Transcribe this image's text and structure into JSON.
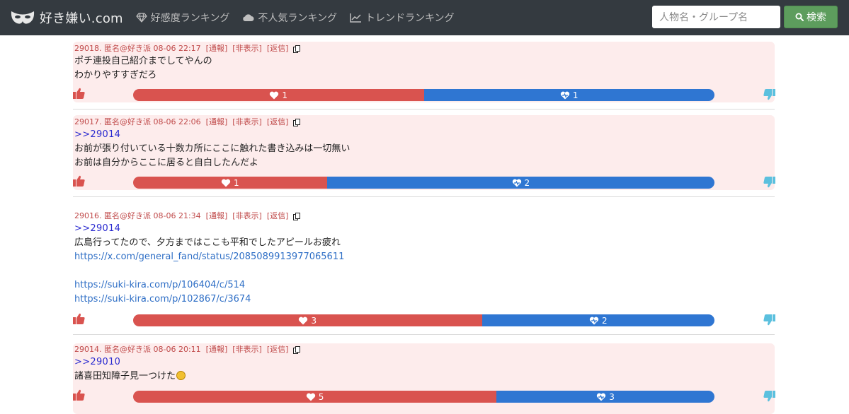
{
  "header": {
    "brand": "好き嫌い.com",
    "nav": [
      {
        "label": "好感度ランキング",
        "icon": "diamond-icon"
      },
      {
        "label": "不人気ランキング",
        "icon": "cloud-icon"
      },
      {
        "label": "トレンドランキング",
        "icon": "chart-line-icon"
      }
    ],
    "search_placeholder": "人物名・グループ名",
    "search_button": "検索"
  },
  "actions": {
    "report": "[通報]",
    "hide": "[非表示]",
    "reply": "[返信]"
  },
  "posts": [
    {
      "header": "29018. 匿名@好き派 08-06 22:17",
      "highlight": true,
      "lines": [
        "ポチ連投自己紹介までしてやんの",
        "わかりやすすぎだろ"
      ],
      "likes": 1,
      "dislikes": 1
    },
    {
      "header": "29017. 匿名@好き派 08-06 22:06",
      "highlight": true,
      "anchor": ">>29014",
      "lines": [
        "お前が張り付いている十数カ所にここに触れた書き込みは一切無い",
        "お前は自分からここに居ると自白したんだよ"
      ],
      "likes": 1,
      "dislikes": 2
    },
    {
      "header": "29016. 匿名@好き派 08-06 21:34",
      "highlight": false,
      "anchor": ">>29014",
      "lines": [
        "広島行ってたので、夕方まではここも平和でしたアピールお疲れ"
      ],
      "links": [
        "https://x.com/general_fand/status/2085089913977065611",
        "https://suki-kira.com/p/106404/c/514",
        "https://suki-kira.com/p/102867/c/3674"
      ],
      "likes": 3,
      "dislikes": 2
    },
    {
      "header": "29014. 匿名@好き派 08-06 20:11",
      "highlight": true,
      "anchor": ">>29010",
      "lines": [
        "諸喜田知障子見一つけた"
      ],
      "likes": 5,
      "dislikes": 3
    }
  ],
  "colors": {
    "like": "#d9534f",
    "dislike": "#2f76d2",
    "highlight": "#fdecec",
    "navbar": "#343a40",
    "search_button": "#5d9d5d"
  }
}
